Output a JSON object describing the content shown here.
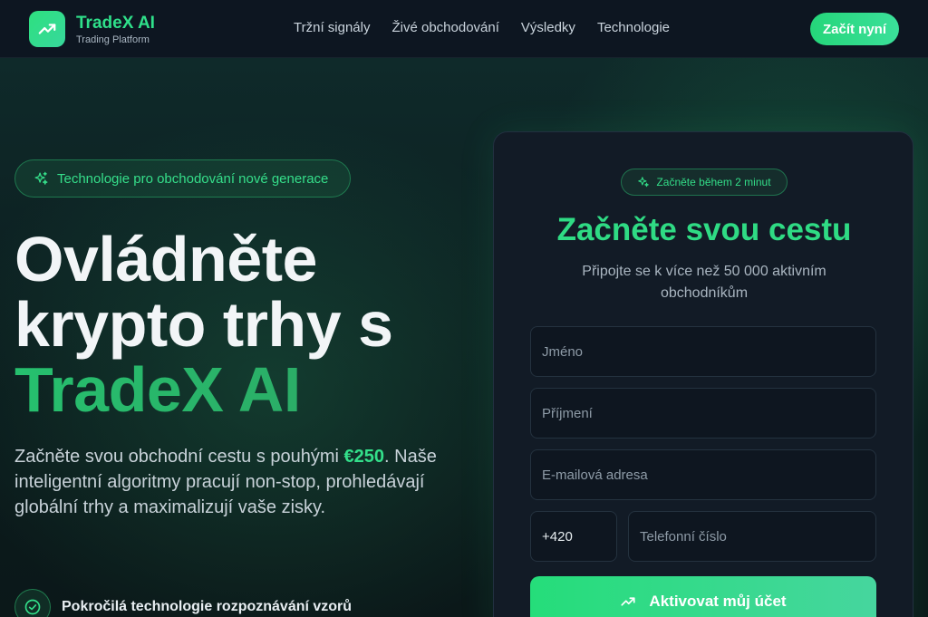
{
  "brand": {
    "name": "TradeX AI",
    "subtitle": "Trading Platform",
    "logo_icon": "trending-up-icon"
  },
  "nav": [
    "Tržní signály",
    "Živé obchodování",
    "Výsledky",
    "Technologie"
  ],
  "header_cta": "Začít nyní",
  "hero": {
    "badge": "Technologie pro obchodování nové generace",
    "title_line1": "Ovládněte",
    "title_line2": "krypto trhy s",
    "title_accent": "TradeX AI",
    "lead_before": "Začněte svou obchodní cestu s pouhými ",
    "lead_amount": "€250",
    "lead_after": ". Naše inteligentní algoritmy pracují non-stop, prohledávají globální trhy a maximalizují vaše zisky.",
    "features": [
      "Pokročilá technologie rozpoznávání vzorů"
    ]
  },
  "form": {
    "badge": "Začněte během 2 minut",
    "title": "Začněte svou cestu",
    "subtitle": "Připojte se k více než 50 000 aktivním obchodníkům",
    "first_name_placeholder": "Jméno",
    "last_name_placeholder": "Příjmení",
    "email_placeholder": "E-mailová adresa",
    "phone_prefix": "+420",
    "phone_placeholder": "Telefonní číslo",
    "submit_label": "Aktivovat můj účet"
  },
  "colors": {
    "accent": "#2fe08a",
    "background": "#0b1a1a",
    "card": "#121b26"
  }
}
